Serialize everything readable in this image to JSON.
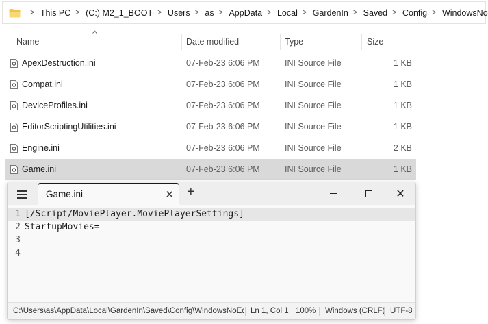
{
  "explorer": {
    "breadcrumb": [
      "This PC",
      "(C:) M2_1_BOOT",
      "Users",
      "as",
      "AppData",
      "Local",
      "GardenIn",
      "Saved",
      "Config",
      "WindowsNoEditor"
    ],
    "columns": {
      "name": "Name",
      "date_modified": "Date modified",
      "type": "Type",
      "size": "Size"
    },
    "sort_indicator": "^",
    "files": [
      {
        "name": "ApexDestruction.ini",
        "date": "07-Feb-23 6:06 PM",
        "type": "INI Source File",
        "size": "1 KB"
      },
      {
        "name": "Compat.ini",
        "date": "07-Feb-23 6:06 PM",
        "type": "INI Source File",
        "size": "1 KB"
      },
      {
        "name": "DeviceProfiles.ini",
        "date": "07-Feb-23 6:06 PM",
        "type": "INI Source File",
        "size": "1 KB"
      },
      {
        "name": "EditorScriptingUtilities.ini",
        "date": "07-Feb-23 6:06 PM",
        "type": "INI Source File",
        "size": "1 KB"
      },
      {
        "name": "Engine.ini",
        "date": "07-Feb-23 6:06 PM",
        "type": "INI Source File",
        "size": "2 KB"
      },
      {
        "name": "Game.ini",
        "date": "07-Feb-23 6:06 PM",
        "type": "INI Source File",
        "size": "1 KB"
      }
    ],
    "selected_file": "Game.ini"
  },
  "notepad": {
    "tab_title": "Game.ini",
    "new_tab": "+",
    "lines": [
      {
        "num": "1",
        "text": "[/Script/MoviePlayer.MoviePlayerSettings]"
      },
      {
        "num": "2",
        "text": "StartupMovies="
      },
      {
        "num": "3",
        "text": ""
      },
      {
        "num": "4",
        "text": ""
      }
    ],
    "status": {
      "path": "C:\\Users\\as\\AppData\\Local\\GardenIn\\Saved\\Config\\WindowsNoEditor",
      "position": "Ln 1, Col 1",
      "zoom": "100%",
      "line_ending": "Windows (CRLF)",
      "encoding": "UTF-8"
    }
  },
  "colors": {
    "selected_row": "#d9d9d9",
    "folder_yellow": "#f3c343",
    "tab_underline": "#1a1a1a"
  },
  "icons": {
    "folder": "folder-icon",
    "file": "ini-file-icon",
    "close": "close-icon",
    "minimize": "minimize-icon",
    "maximize": "maximize-icon",
    "menu": "hamburger-menu-icon",
    "chevron": "chevron-right-icon"
  }
}
